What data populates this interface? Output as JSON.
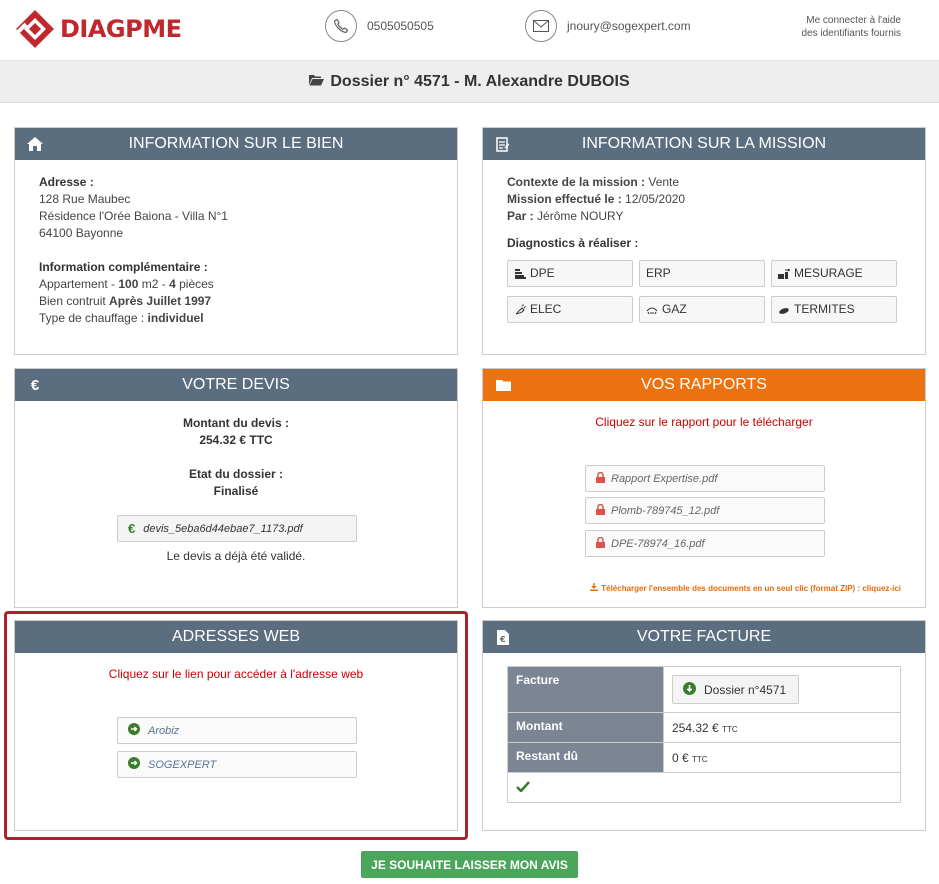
{
  "header": {
    "logo_text": "DIAGPME",
    "phone": "0505050505",
    "email": "jnoury@sogexpert.com",
    "connect_line1": "Me connecter à l'aide",
    "connect_line2": "des identifiants fournis"
  },
  "dossier": {
    "title": "Dossier n° 4571 - M. Alexandre DUBOIS"
  },
  "bien": {
    "title": "INFORMATION SUR LE BIEN",
    "adresse_label": "Adresse :",
    "adresse_lines": [
      "128 Rue Maubec",
      "Résidence l'Orée Baiona - Villa N°1",
      "64100 Bayonne"
    ],
    "info_label": "Information complémentaire :",
    "appart_prefix": "Appartement - ",
    "appart_m2": "100",
    "appart_mid": " m2 - ",
    "appart_pieces": "4",
    "appart_suffix": " pièces",
    "construit_prefix": "Bien contruit ",
    "construit_value": "Après Juillet 1997",
    "chauffage_prefix": "Type de chauffage : ",
    "chauffage_value": "individuel"
  },
  "mission": {
    "title": "INFORMATION SUR LA MISSION",
    "contexte_label": "Contexte de la mission :",
    "contexte_value": " Vente",
    "effectue_label": "Mission effectué le :",
    "effectue_value": " 12/05/2020",
    "par_label": "Par :",
    "par_value": " Jérôme NOURY",
    "diagnostics_label": "Diagnostics à réaliser :",
    "diagnostics": [
      {
        "label": "DPE",
        "icon": "dpe-icon"
      },
      {
        "label": "ERP",
        "icon": ""
      },
      {
        "label": "MESURAGE",
        "icon": "mesurage-icon"
      },
      {
        "label": "ELEC",
        "icon": "elec-icon"
      },
      {
        "label": "GAZ",
        "icon": "gaz-icon"
      },
      {
        "label": "TERMITES",
        "icon": "termites-icon"
      }
    ]
  },
  "devis": {
    "title": "VOTRE DEVIS",
    "montant_label": "Montant du devis :",
    "montant_value": "254.32 € TTC",
    "etat_label": "Etat du dossier :",
    "etat_value": "Finalisé",
    "file": "devis_5eba6d44ebae7_1173.pdf",
    "validated": "Le devis a déjà été validé."
  },
  "rapports": {
    "title": "VOS RAPPORTS",
    "instruction": "Cliquez sur le rapport pour le télécharger",
    "files": [
      "Rapport Expertise.pdf",
      "Plomb-789745_12.pdf",
      "DPE-78974_16.pdf"
    ],
    "zip_text": "Télécharger l'ensemble des documents en un seul clic (format ZIP) : cliquez-ici"
  },
  "web": {
    "title": "ADRESSES WEB",
    "instruction": "Cliquez sur le lien pour accéder à l'adresse web",
    "links": [
      "Arobiz",
      "SOGEXPERT"
    ]
  },
  "facture": {
    "title": "VOTRE FACTURE",
    "facture_label": "Facture",
    "facture_button": "Dossier n°4571",
    "montant_label": "Montant",
    "montant_value": "254.32 €",
    "montant_unit": "TTC",
    "restant_label": "Restant dû",
    "restant_value": "0 €",
    "restant_unit": "TTC"
  },
  "avis_button": "JE SOUHAITE LAISSER MON AVIS",
  "colors": {
    "brand_red": "#c0282d",
    "panel_header": "#5a6e80",
    "orange": "#ec7210",
    "green": "#4aa65b",
    "highlight": "#a8242b"
  }
}
